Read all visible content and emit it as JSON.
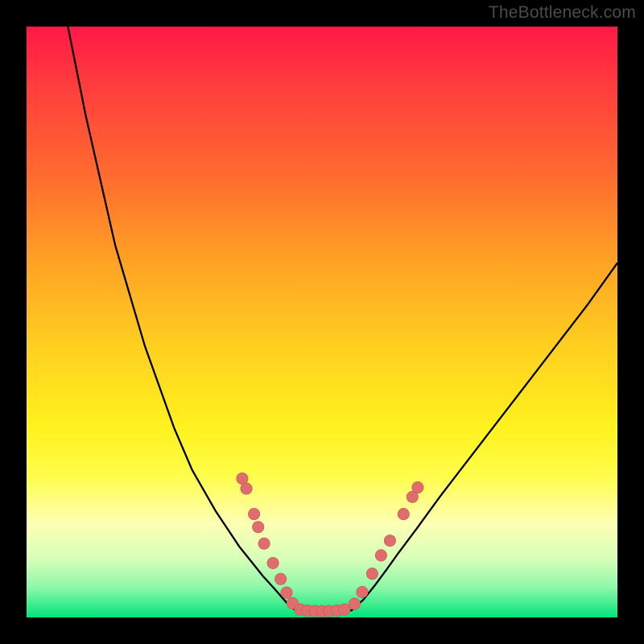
{
  "watermark": "TheBottleneck.com",
  "chart_data": {
    "type": "line",
    "title": "",
    "xlabel": "",
    "ylabel": "",
    "xlim": [
      0,
      100
    ],
    "ylim": [
      0,
      100
    ],
    "series": [
      {
        "name": "left-curve",
        "x": [
          7,
          10,
          15,
          20,
          25,
          28,
          30,
          32,
          34,
          36,
          38,
          40,
          42,
          44,
          45.5
        ],
        "y": [
          100,
          85,
          63,
          46,
          32,
          25,
          21.5,
          18,
          15,
          12,
          9.5,
          7,
          4.8,
          2.5,
          1.2
        ]
      },
      {
        "name": "floor",
        "x": [
          45.5,
          47,
          49,
          51,
          53,
          55
        ],
        "y": [
          1.2,
          0.9,
          0.85,
          0.85,
          0.9,
          1.2
        ]
      },
      {
        "name": "right-curve",
        "x": [
          55,
          57,
          59,
          61,
          63,
          66,
          70,
          75,
          80,
          85,
          90,
          95,
          100
        ],
        "y": [
          1.2,
          3,
          5.5,
          8.2,
          11,
          15,
          20.5,
          27,
          33.5,
          40,
          46.5,
          53,
          60
        ]
      }
    ],
    "markers": [
      {
        "x": 36.5,
        "y": 23.5
      },
      {
        "x": 37.2,
        "y": 21.8
      },
      {
        "x": 38.5,
        "y": 17.5
      },
      {
        "x": 39.2,
        "y": 15.3
      },
      {
        "x": 40.2,
        "y": 12.5
      },
      {
        "x": 41.7,
        "y": 9.2
      },
      {
        "x": 43.0,
        "y": 6.5
      },
      {
        "x": 44.0,
        "y": 4.2
      },
      {
        "x": 45.0,
        "y": 2.4
      },
      {
        "x": 46.3,
        "y": 1.35
      },
      {
        "x": 47.5,
        "y": 1.15
      },
      {
        "x": 48.8,
        "y": 1.08
      },
      {
        "x": 50.0,
        "y": 1.05
      },
      {
        "x": 51.2,
        "y": 1.08
      },
      {
        "x": 52.5,
        "y": 1.15
      },
      {
        "x": 53.8,
        "y": 1.35
      },
      {
        "x": 55.5,
        "y": 2.3
      },
      {
        "x": 56.8,
        "y": 4.3
      },
      {
        "x": 58.5,
        "y": 7.4
      },
      {
        "x": 60.0,
        "y": 10.5
      },
      {
        "x": 61.5,
        "y": 13.0
      },
      {
        "x": 63.8,
        "y": 17.5
      },
      {
        "x": 65.3,
        "y": 20.4
      },
      {
        "x": 66.2,
        "y": 22.0
      }
    ],
    "colors": {
      "curve": "#000000",
      "marker_fill": "#e06d6d",
      "marker_stroke": "#c95555"
    }
  }
}
